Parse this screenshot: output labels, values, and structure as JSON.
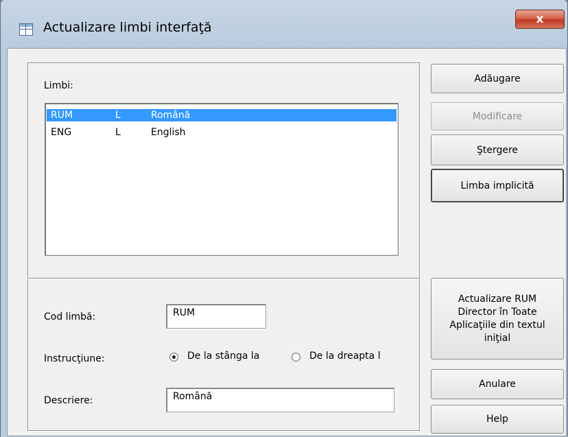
{
  "window": {
    "title": "Actualizare limbi interfaţă",
    "close_glyph": "x"
  },
  "languages": {
    "label": "Limbi:",
    "items": [
      {
        "code": "RUM",
        "dir": "L",
        "name": "Română",
        "selected": true
      },
      {
        "code": "ENG",
        "dir": "L",
        "name": "English",
        "selected": false
      }
    ]
  },
  "form": {
    "code_label": "Cod limbă:",
    "code_value": "RUM",
    "instruction_label": "Instrucţiune:",
    "ltr_label": "De la stânga la",
    "rtl_label": "De la dreapta l",
    "selected_direction": "ltr",
    "description_label": "Descriere:",
    "description_value": "Română"
  },
  "buttons": {
    "add": "Adăugare",
    "modify": "Modificare",
    "delete": "Ştergere",
    "default_language": "Limba implicită",
    "update_line1": "Actualizare  RUM",
    "update_line2": "Director în Toate",
    "update_line3": "Aplicaţiile din textul",
    "update_line4": "iniţial",
    "cancel": "Anulare",
    "help": "Help"
  }
}
